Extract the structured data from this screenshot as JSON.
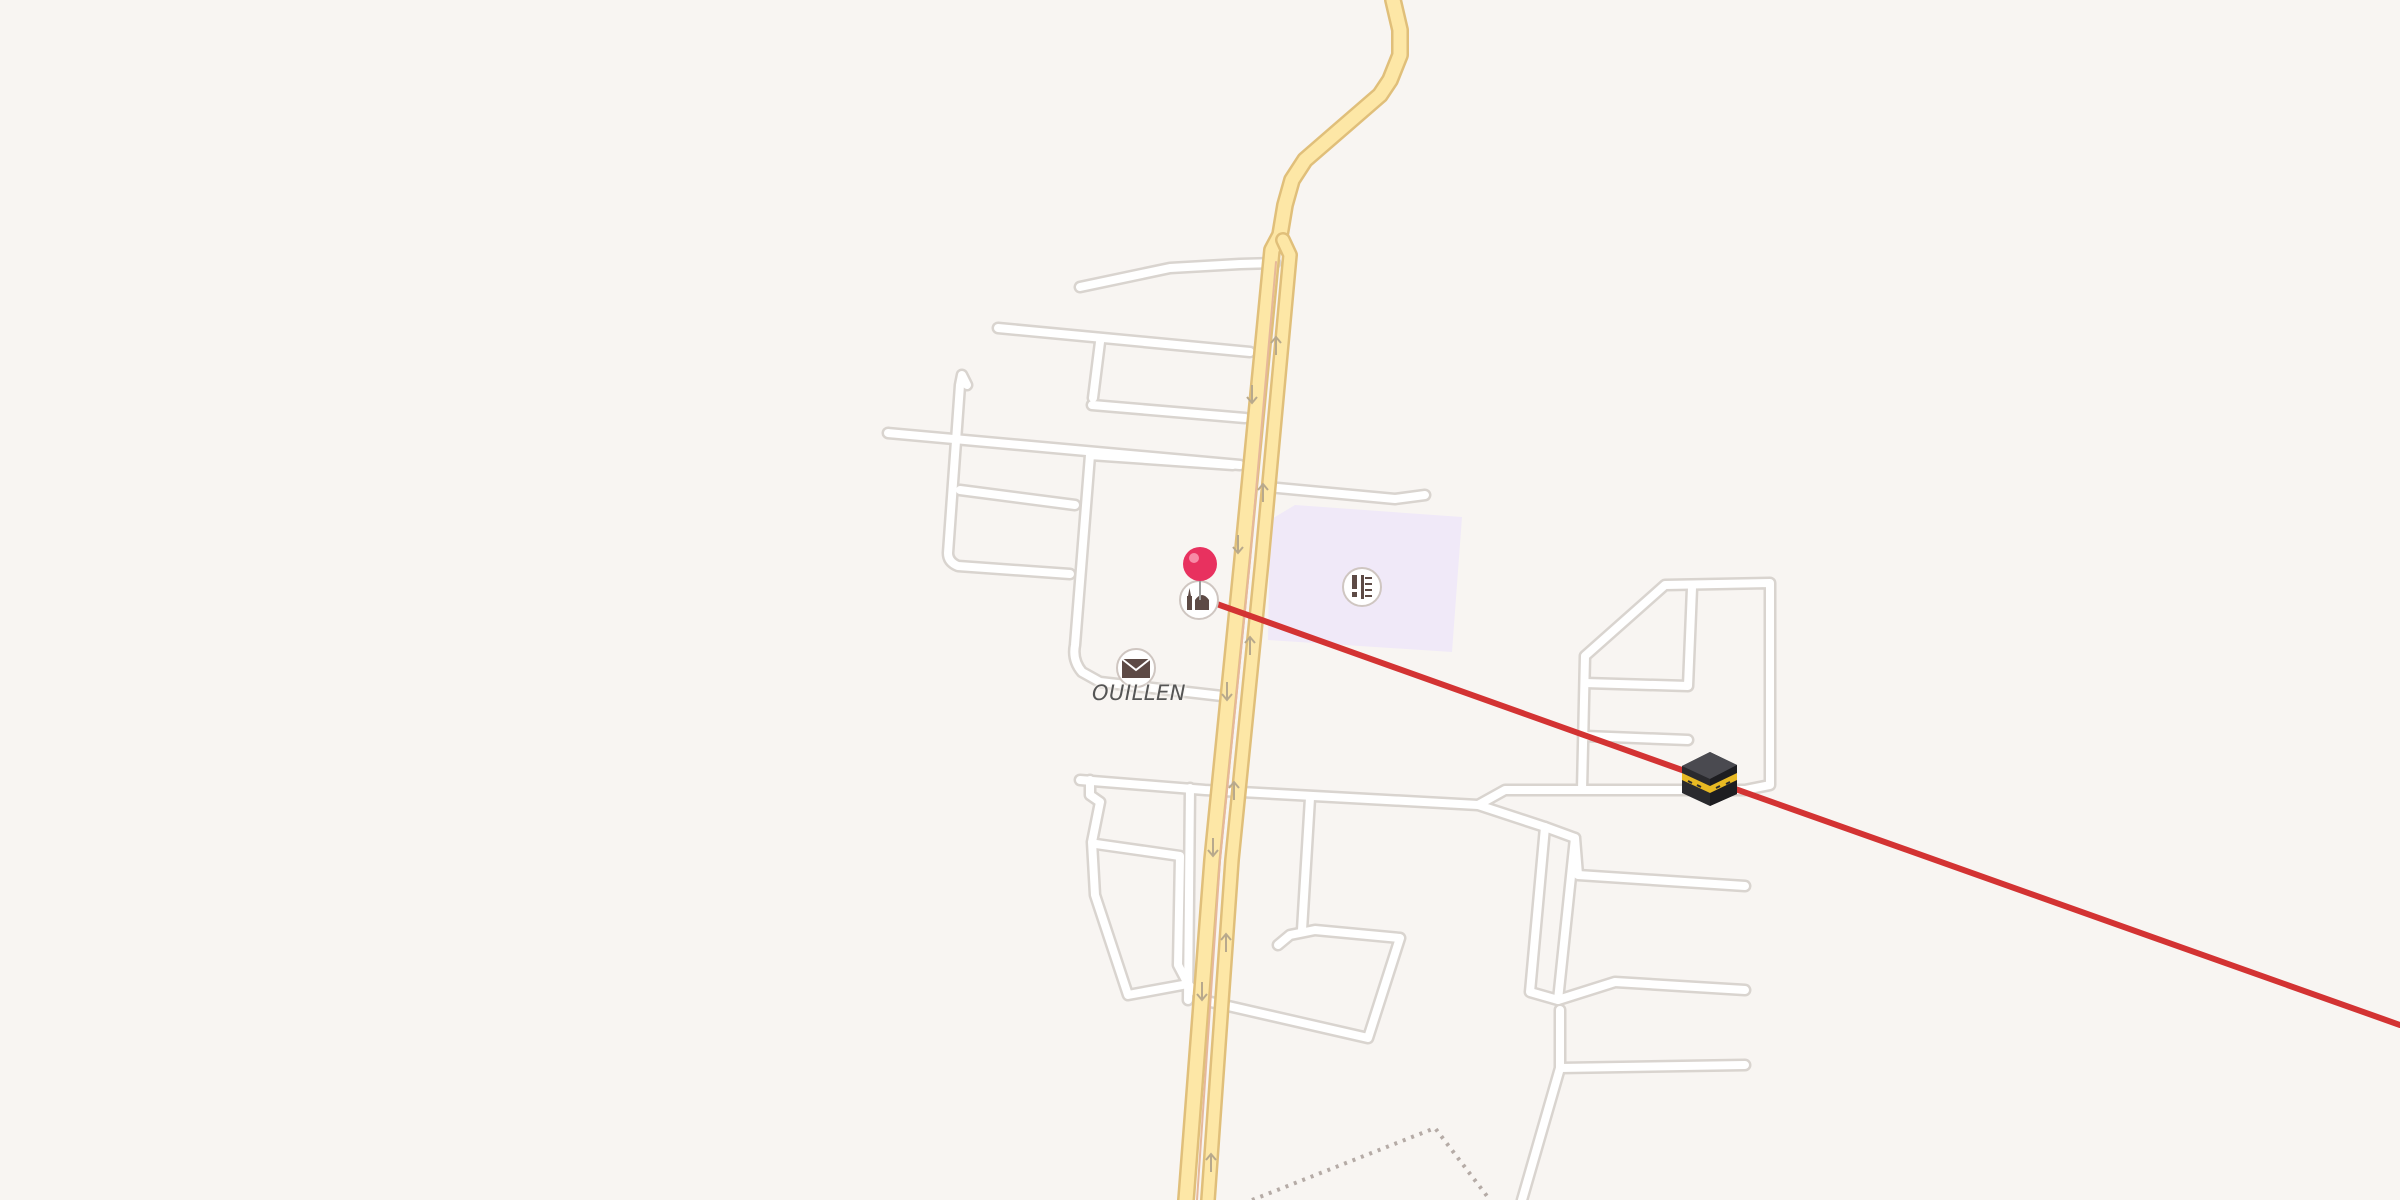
{
  "map": {
    "place_label": "OUILLEN",
    "colors": {
      "background": "#f8f5f2",
      "primary_road_fill": "#fde7a6",
      "primary_road_casing": "#e0bf7a",
      "minor_road_fill": "#ffffff",
      "minor_road_casing": "#d9d4cf",
      "school_area": "#f0e9f8",
      "route_line": "#d33333",
      "pin": "#e8315f",
      "poi_icon": "#5d4a45",
      "dotted_path": "#b5aba6"
    },
    "icons": {
      "location_pin": "map-pin",
      "mosque": "mosque-icon",
      "post_office": "post-office-icon",
      "school": "school-icon",
      "kaaba": "kaaba-icon",
      "oneway_arrows": "arrow-icon"
    }
  }
}
